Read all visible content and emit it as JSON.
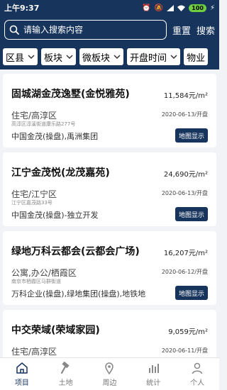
{
  "status_bar": {
    "time": "上午9:37",
    "battery": "100"
  },
  "header": {
    "search_placeholder": "请输入搜索内容",
    "reset_label": "重置",
    "search_label": "搜索"
  },
  "filters": [
    "区县",
    "板块",
    "微板块",
    "开盘时间",
    "物业"
  ],
  "projects": [
    {
      "name": "固城湖金茂逸墅(金悦雅苑)",
      "price": "11,584元/m²",
      "type": "住宅/高淳区",
      "date": "2020-06-13/开盘",
      "address": "高淳区淳溪街道康乐路277号",
      "developer": "中国金茂(操盘),禹洲集团",
      "map_label": "地图显示"
    },
    {
      "name": "江宁金茂悦(龙茂嘉苑)",
      "price": "24,690元/m²",
      "type": "住宅/江宁区",
      "date": "2020-06-13/开盘",
      "address": "江宁区嘉茂路33号",
      "developer": "中国金茂(操盘)-独立开发",
      "map_label": "地图显示"
    },
    {
      "name": "绿地万科云都会(云都会广场)",
      "price": "16,207元/m²",
      "type": "公寓,办公/栖霞区",
      "date": "2020-06-12/开盘",
      "address": "南京市栖霞区马群街道",
      "developer": "万科企业(操盘),绿地集团(操盘),地铁地",
      "map_label": "地图显示"
    },
    {
      "name": "中交荣域(荣域家园)",
      "price": "9,059元/m²",
      "type": "住宅/高淳区",
      "date": "2020-06-11/开盘",
      "address": "",
      "developer": "",
      "map_label": ""
    }
  ],
  "nav": [
    {
      "label": "项目",
      "icon": "home-icon",
      "active": true
    },
    {
      "label": "土地",
      "icon": "hammer-icon",
      "active": false
    },
    {
      "label": "周边",
      "icon": "location-pin-icon",
      "active": false
    },
    {
      "label": "统计",
      "icon": "bar-chart-icon",
      "active": false
    },
    {
      "label": "个人",
      "icon": "person-icon",
      "active": false
    }
  ]
}
